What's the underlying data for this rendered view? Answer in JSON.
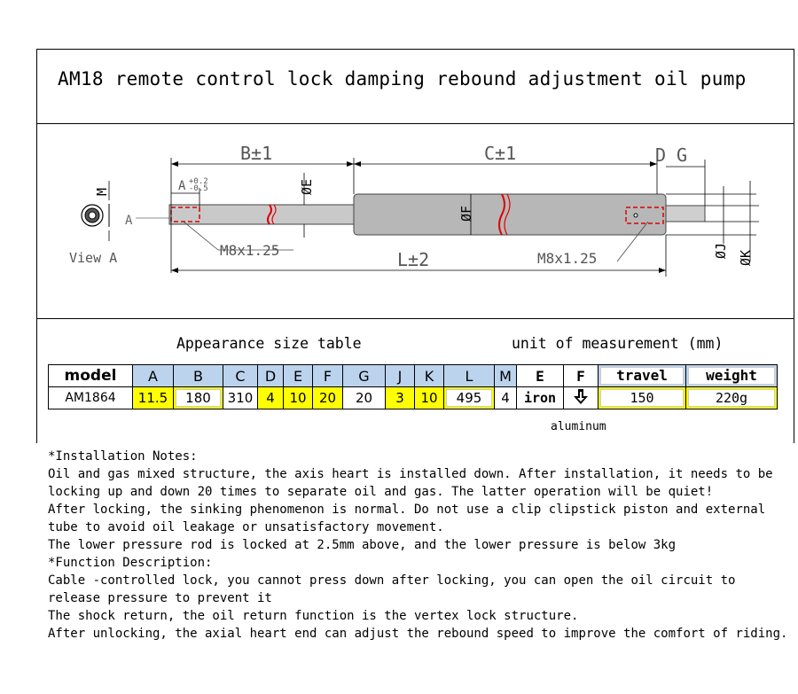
{
  "title": "AM18 remote control lock damping rebound adjustment oil pump",
  "drawing": {
    "labels": {
      "b": "B±1",
      "c": "C±1",
      "d": "D",
      "g": "G",
      "a": "A",
      "a_tol_top": "+0.2",
      "a_tol_bottom": "-0.5",
      "m": "M",
      "e": "ØE",
      "f": "ØF",
      "j": "ØJ",
      "k": "ØK",
      "l": "L±2",
      "thread_left": "M8x1.25",
      "thread_right": "M8x1.25",
      "view": "View A",
      "view_arrow": "A"
    }
  },
  "table": {
    "heading": "Appearance size table",
    "unit": "unit of measurement  (mm)",
    "headers": [
      "model",
      "A",
      "B",
      "C",
      "D",
      "E",
      "F",
      "G",
      "J",
      "K",
      "L",
      "M",
      "E",
      "F",
      "travel",
      "weight"
    ],
    "values": [
      "AM1864",
      "11.5",
      "180",
      "310",
      "4",
      "10",
      "20",
      "20",
      "3",
      "10",
      "495",
      "4",
      "iron",
      "",
      "150",
      "220g"
    ],
    "f_note": "aluminum"
  },
  "notes": [
    "*Installation Notes:",
    "Oil and gas mixed structure, the axis heart is installed down. After installation, it needs to be locking up and down 20 times to separate oil and gas. The latter operation will be quiet!",
    "After locking, the sinking phenomenon is normal. Do not use a clip clipstick piston and external tube to avoid oil leakage or unsatisfactory movement.",
    "The lower pressure rod is locked at 2.5mm above, and the lower pressure is below 3kg",
    "*Function Description:",
    "Cable -controlled lock, you cannot press down after locking, you can open the oil circuit to release pressure to prevent it",
    "The shock return, the oil return function is the vertex lock structure.",
    "After unlocking, the axial heart end can adjust the rebound speed to improve the comfort of riding."
  ]
}
